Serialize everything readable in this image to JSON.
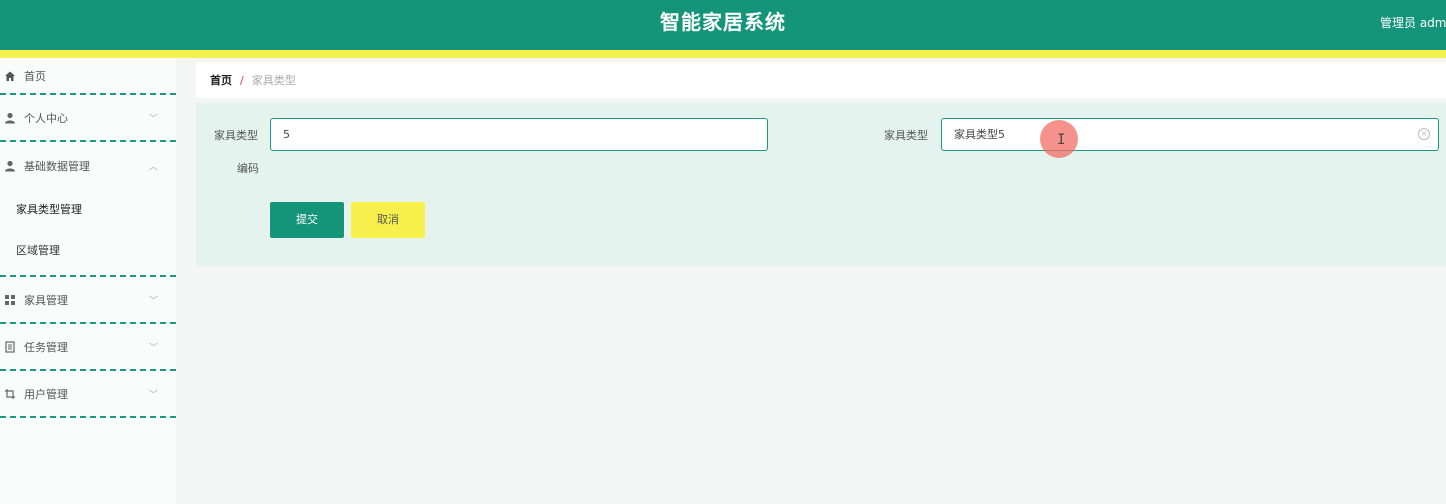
{
  "header": {
    "title": "智能家居系统",
    "user": "管理员 adm"
  },
  "sidebar": {
    "items": [
      {
        "label": "首页",
        "icon": "home-icon"
      },
      {
        "label": "个人中心",
        "icon": "user-icon"
      },
      {
        "label": "基础数据管理",
        "icon": "user-icon",
        "children": [
          {
            "label": "家具类型管理"
          },
          {
            "label": "区域管理"
          }
        ]
      },
      {
        "label": "家具管理",
        "icon": "grid-icon"
      },
      {
        "label": "任务管理",
        "icon": "document-icon"
      },
      {
        "label": "用户管理",
        "icon": "crop-icon"
      }
    ]
  },
  "breadcrumb": {
    "home": "首页",
    "separator": "/",
    "current": "家具类型"
  },
  "form": {
    "code_label_line1": "家具类型",
    "code_label_line2": "编码",
    "code_value": "5",
    "type_label": "家具类型",
    "type_value": "家具类型5",
    "submit_label": "提交",
    "cancel_label": "取消"
  },
  "colors": {
    "primary": "#14957a",
    "accent": "#f4f24a",
    "panel": "#e4f3ee"
  }
}
